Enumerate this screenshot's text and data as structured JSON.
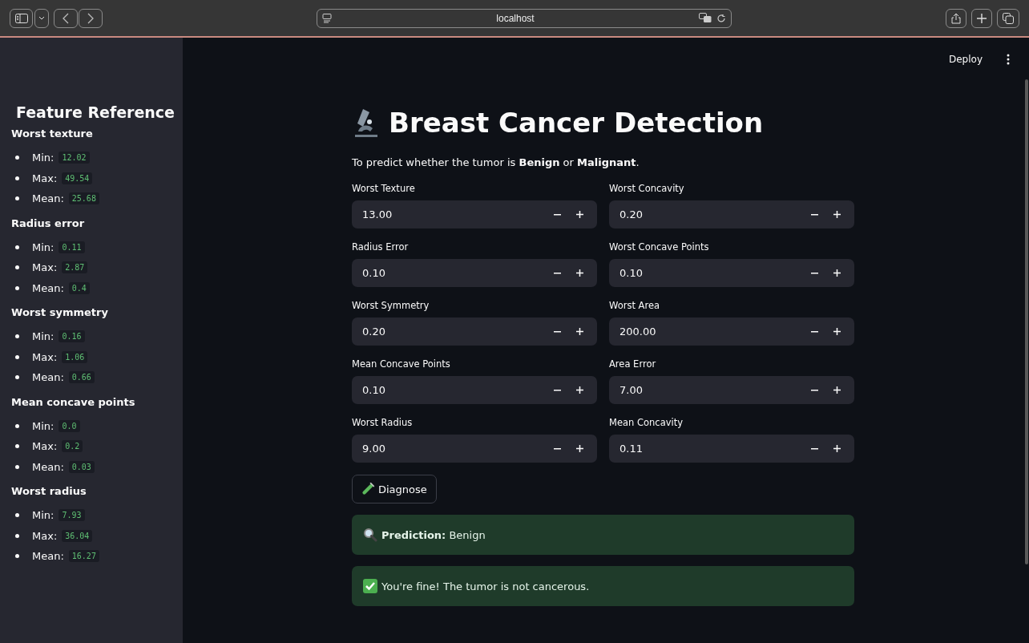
{
  "browser": {
    "url": "localhost"
  },
  "header": {
    "deploy": "Deploy"
  },
  "sidebar": {
    "title": "Feature Reference",
    "features": [
      {
        "name": "Worst texture",
        "stats": [
          {
            "label": "Min:",
            "value": "12.02"
          },
          {
            "label": "Max:",
            "value": "49.54"
          },
          {
            "label": "Mean:",
            "value": "25.68"
          }
        ]
      },
      {
        "name": "Radius error",
        "stats": [
          {
            "label": "Min:",
            "value": "0.11"
          },
          {
            "label": "Max:",
            "value": "2.87"
          },
          {
            "label": "Mean:",
            "value": "0.4"
          }
        ]
      },
      {
        "name": "Worst symmetry",
        "stats": [
          {
            "label": "Min:",
            "value": "0.16"
          },
          {
            "label": "Max:",
            "value": "1.06"
          },
          {
            "label": "Mean:",
            "value": "0.66"
          }
        ]
      },
      {
        "name": "Mean concave points",
        "stats": [
          {
            "label": "Min:",
            "value": "0.0"
          },
          {
            "label": "Max:",
            "value": "0.2"
          },
          {
            "label": "Mean:",
            "value": "0.03"
          }
        ]
      },
      {
        "name": "Worst radius",
        "stats": [
          {
            "label": "Min:",
            "value": "7.93"
          },
          {
            "label": "Max:",
            "value": "36.04"
          },
          {
            "label": "Mean:",
            "value": "16.27"
          }
        ]
      }
    ]
  },
  "main": {
    "title": "Breast Cancer Detection",
    "intro": "To predict whether the tumor is **Benign** or **Malignant**.",
    "inputs": [
      {
        "label": "Worst Texture",
        "value": "13.00"
      },
      {
        "label": "Worst Concavity",
        "value": "0.20"
      },
      {
        "label": "Radius Error",
        "value": "0.10"
      },
      {
        "label": "Worst Concave Points",
        "value": "0.10"
      },
      {
        "label": "Worst Symmetry",
        "value": "0.20"
      },
      {
        "label": "Worst Area",
        "value": "200.00"
      },
      {
        "label": "Mean Concave Points",
        "value": "0.10"
      },
      {
        "label": "Area Error",
        "value": "7.00"
      },
      {
        "label": "Worst Radius",
        "value": "9.00"
      },
      {
        "label": "Mean Concavity",
        "value": "0.11"
      }
    ],
    "button": "Diagnose",
    "alerts": [
      {
        "kind": "prediction",
        "text": "**Prediction:** Benign"
      },
      {
        "kind": "success",
        "text": "You're fine! The tumor is not cancerous."
      }
    ]
  }
}
